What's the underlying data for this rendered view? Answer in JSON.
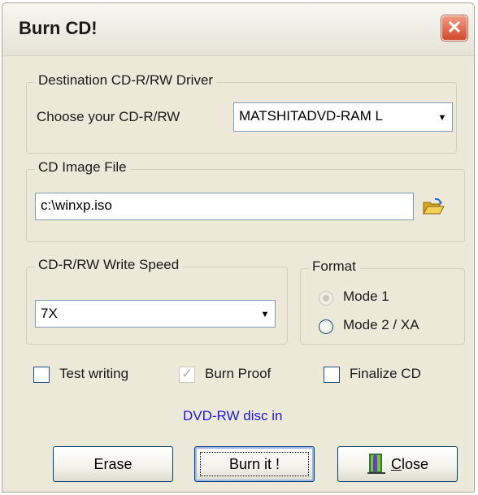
{
  "window": {
    "title": "Burn CD!",
    "close_glyph": "✕"
  },
  "destination": {
    "legend": "Destination CD-R/RW Driver",
    "choose_label": "Choose your CD-R/RW",
    "drive_value": "MATSHITADVD-RAM L"
  },
  "image_file": {
    "legend": "CD Image File",
    "path_value": "c:\\winxp.iso",
    "browse_icon": "folder-open-icon"
  },
  "write_speed": {
    "legend": "CD-R/RW Write Speed",
    "value": "7X"
  },
  "format": {
    "legend": "Format",
    "options": [
      {
        "label": "Mode 1",
        "selected": true,
        "enabled": false
      },
      {
        "label": "Mode 2 / XA",
        "selected": false,
        "enabled": true
      }
    ]
  },
  "options": {
    "test_writing": {
      "label": "Test writing",
      "checked": false,
      "enabled": true
    },
    "burn_proof": {
      "label": "Burn Proof",
      "checked": true,
      "enabled": false
    },
    "finalize_cd": {
      "label": "Finalize CD",
      "checked": false,
      "enabled": true
    }
  },
  "status": {
    "text": "DVD-RW disc in",
    "color": "#1a1adc"
  },
  "buttons": {
    "erase": "Erase",
    "burn": "Burn it !",
    "close": "Close",
    "close_mnemonic": "C",
    "close_rest": "lose",
    "close_icon": "exit-door-icon"
  }
}
